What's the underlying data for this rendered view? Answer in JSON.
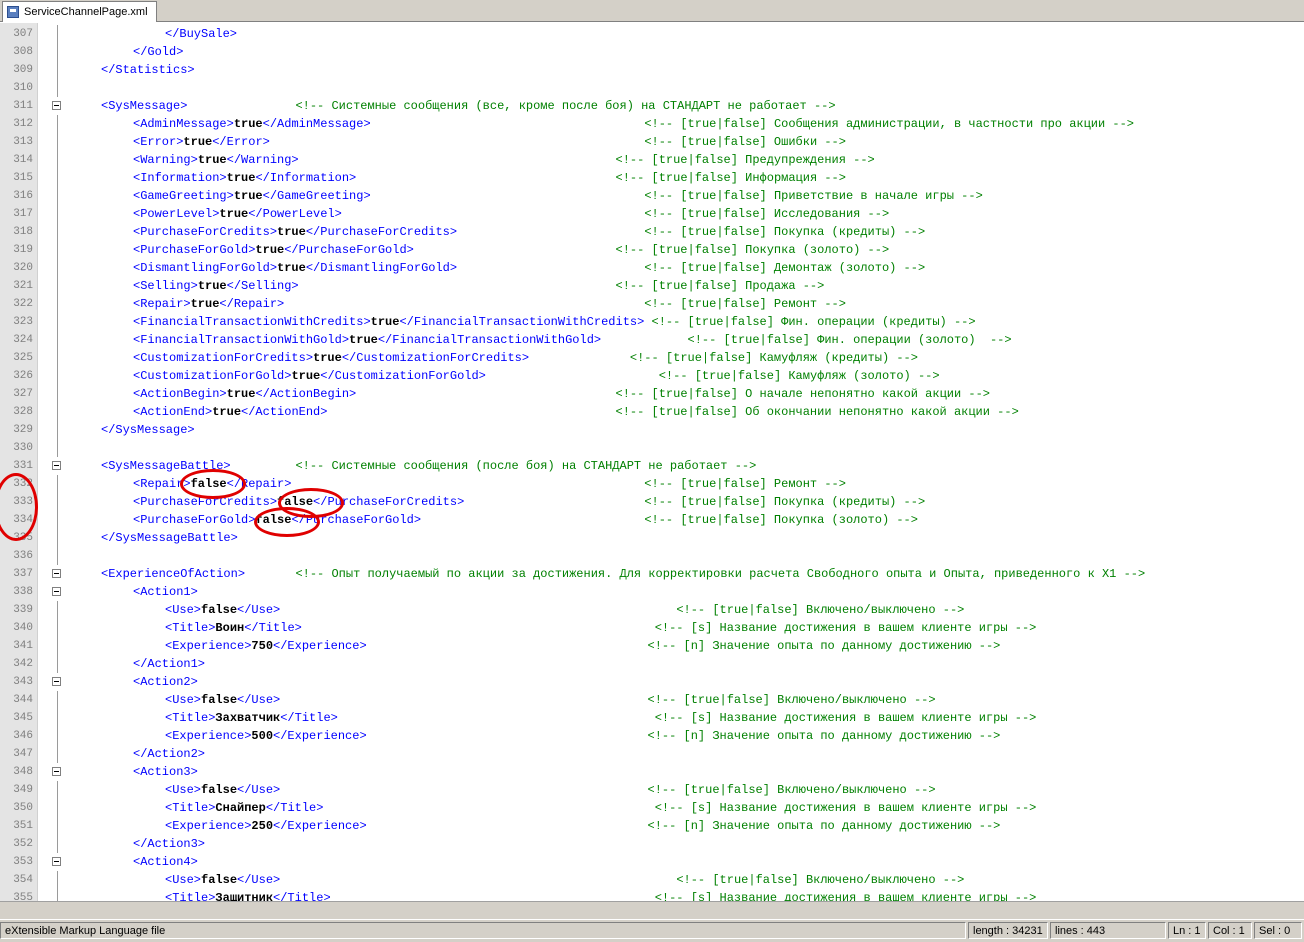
{
  "tab": {
    "filename": "ServiceChannelPage.xml"
  },
  "status": {
    "filetype": "eXtensible Markup Language file",
    "length": "length : 34231",
    "lines": "lines : 443",
    "ln": "Ln : 1",
    "col": "Col : 1",
    "sel": "Sel : 0"
  },
  "lines": [
    {
      "num": "307",
      "indent": 3,
      "parts": [
        [
          "t",
          "</BuySale>"
        ]
      ]
    },
    {
      "num": "308",
      "indent": 2,
      "parts": [
        [
          "t",
          "</Gold>"
        ]
      ]
    },
    {
      "num": "309",
      "indent": 1,
      "parts": [
        [
          "t",
          "</Statistics>"
        ]
      ]
    },
    {
      "num": "310",
      "indent": 0,
      "parts": []
    },
    {
      "num": "311",
      "indent": 1,
      "fold": true,
      "parts": [
        [
          "t",
          "<SysMessage>"
        ],
        [
          "s",
          "               "
        ],
        [
          "c",
          "<!-- Системные сообщения (все, кроме после боя) на СТАНДАРТ не работает -->"
        ]
      ]
    },
    {
      "num": "312",
      "indent": 2,
      "parts": [
        [
          "t",
          "<AdminMessage>"
        ],
        [
          "v",
          "true"
        ],
        [
          "t",
          "</AdminMessage>"
        ],
        [
          "s",
          "                                      "
        ],
        [
          "c",
          "<!-- [true|false] Сообщения администрации, в частности про акции -->"
        ]
      ]
    },
    {
      "num": "313",
      "indent": 2,
      "parts": [
        [
          "t",
          "<Error>"
        ],
        [
          "v",
          "true"
        ],
        [
          "t",
          "</Error>"
        ],
        [
          "s",
          "                                                    "
        ],
        [
          "c",
          "<!-- [true|false] Ошибки -->"
        ]
      ]
    },
    {
      "num": "314",
      "indent": 2,
      "parts": [
        [
          "t",
          "<Warning>"
        ],
        [
          "v",
          "true"
        ],
        [
          "t",
          "</Warning>"
        ],
        [
          "s",
          "                                            "
        ],
        [
          "c",
          "<!-- [true|false] Предупреждения -->"
        ]
      ]
    },
    {
      "num": "315",
      "indent": 2,
      "parts": [
        [
          "t",
          "<Information>"
        ],
        [
          "v",
          "true"
        ],
        [
          "t",
          "</Information>"
        ],
        [
          "s",
          "                                    "
        ],
        [
          "c",
          "<!-- [true|false] Информация -->"
        ]
      ]
    },
    {
      "num": "316",
      "indent": 2,
      "parts": [
        [
          "t",
          "<GameGreeting>"
        ],
        [
          "v",
          "true"
        ],
        [
          "t",
          "</GameGreeting>"
        ],
        [
          "s",
          "                                      "
        ],
        [
          "c",
          "<!-- [true|false] Приветствие в начале игры -->"
        ]
      ]
    },
    {
      "num": "317",
      "indent": 2,
      "parts": [
        [
          "t",
          "<PowerLevel>"
        ],
        [
          "v",
          "true"
        ],
        [
          "t",
          "</PowerLevel>"
        ],
        [
          "s",
          "                                          "
        ],
        [
          "c",
          "<!-- [true|false] Исследования -->"
        ]
      ]
    },
    {
      "num": "318",
      "indent": 2,
      "parts": [
        [
          "t",
          "<PurchaseForCredits>"
        ],
        [
          "v",
          "true"
        ],
        [
          "t",
          "</PurchaseForCredits>"
        ],
        [
          "s",
          "                          "
        ],
        [
          "c",
          "<!-- [true|false] Покупка (кредиты) -->"
        ]
      ]
    },
    {
      "num": "319",
      "indent": 2,
      "parts": [
        [
          "t",
          "<PurchaseForGold>"
        ],
        [
          "v",
          "true"
        ],
        [
          "t",
          "</PurchaseForGold>"
        ],
        [
          "s",
          "                            "
        ],
        [
          "c",
          "<!-- [true|false] Покупка (золото) -->"
        ]
      ]
    },
    {
      "num": "320",
      "indent": 2,
      "parts": [
        [
          "t",
          "<DismantlingForGold>"
        ],
        [
          "v",
          "true"
        ],
        [
          "t",
          "</DismantlingForGold>"
        ],
        [
          "s",
          "                          "
        ],
        [
          "c",
          "<!-- [true|false] Демонтаж (золото) -->"
        ]
      ]
    },
    {
      "num": "321",
      "indent": 2,
      "parts": [
        [
          "t",
          "<Selling>"
        ],
        [
          "v",
          "true"
        ],
        [
          "t",
          "</Selling>"
        ],
        [
          "s",
          "                                            "
        ],
        [
          "c",
          "<!-- [true|false] Продажа -->"
        ]
      ]
    },
    {
      "num": "322",
      "indent": 2,
      "parts": [
        [
          "t",
          "<Repair>"
        ],
        [
          "v",
          "true"
        ],
        [
          "t",
          "</Repair>"
        ],
        [
          "s",
          "                                                  "
        ],
        [
          "c",
          "<!-- [true|false] Ремонт -->"
        ]
      ]
    },
    {
      "num": "323",
      "indent": 2,
      "parts": [
        [
          "t",
          "<FinancialTransactionWithCredits>"
        ],
        [
          "v",
          "true"
        ],
        [
          "t",
          "</FinancialTransactionWithCredits>"
        ],
        [
          "s",
          " "
        ],
        [
          "c",
          "<!-- [true|false] Фин. операции (кредиты) -->"
        ]
      ]
    },
    {
      "num": "324",
      "indent": 2,
      "parts": [
        [
          "t",
          "<FinancialTransactionWithGold>"
        ],
        [
          "v",
          "true"
        ],
        [
          "t",
          "</FinancialTransactionWithGold>"
        ],
        [
          "s",
          "            "
        ],
        [
          "c",
          "<!-- [true|false] Фин. операции (золото)  -->"
        ]
      ]
    },
    {
      "num": "325",
      "indent": 2,
      "parts": [
        [
          "t",
          "<CustomizationForCredits>"
        ],
        [
          "v",
          "true"
        ],
        [
          "t",
          "</CustomizationForCredits>"
        ],
        [
          "s",
          "              "
        ],
        [
          "c",
          "<!-- [true|false] Камуфляж (кредиты) -->"
        ]
      ]
    },
    {
      "num": "326",
      "indent": 2,
      "parts": [
        [
          "t",
          "<CustomizationForGold>"
        ],
        [
          "v",
          "true"
        ],
        [
          "t",
          "</CustomizationForGold>"
        ],
        [
          "s",
          "                        "
        ],
        [
          "c",
          "<!-- [true|false] Камуфляж (золото) -->"
        ]
      ]
    },
    {
      "num": "327",
      "indent": 2,
      "parts": [
        [
          "t",
          "<ActionBegin>"
        ],
        [
          "v",
          "true"
        ],
        [
          "t",
          "</ActionBegin>"
        ],
        [
          "s",
          "                                    "
        ],
        [
          "c",
          "<!-- [true|false] О начале непонятно какой акции -->"
        ]
      ]
    },
    {
      "num": "328",
      "indent": 2,
      "parts": [
        [
          "t",
          "<ActionEnd>"
        ],
        [
          "v",
          "true"
        ],
        [
          "t",
          "</ActionEnd>"
        ],
        [
          "s",
          "                                        "
        ],
        [
          "c",
          "<!-- [true|false] Об окончании непонятно какой акции -->"
        ]
      ]
    },
    {
      "num": "329",
      "indent": 1,
      "parts": [
        [
          "t",
          "</SysMessage>"
        ]
      ]
    },
    {
      "num": "330",
      "indent": 0,
      "parts": []
    },
    {
      "num": "331",
      "indent": 1,
      "fold": true,
      "parts": [
        [
          "t",
          "<SysMessageBattle>"
        ],
        [
          "s",
          "         "
        ],
        [
          "c",
          "<!-- Системные сообщения (после боя) на СТАНДАРТ не работает -->"
        ]
      ]
    },
    {
      "num": "332",
      "indent": 2,
      "parts": [
        [
          "t",
          "<Repair>"
        ],
        [
          "v",
          "false"
        ],
        [
          "t",
          "</Repair>"
        ],
        [
          "s",
          "                                                 "
        ],
        [
          "c",
          "<!-- [true|false] Ремонт -->"
        ]
      ]
    },
    {
      "num": "333",
      "indent": 2,
      "parts": [
        [
          "t",
          "<PurchaseForCredits>"
        ],
        [
          "v",
          "false"
        ],
        [
          "t",
          "</PurchaseForCredits>"
        ],
        [
          "s",
          "                         "
        ],
        [
          "c",
          "<!-- [true|false] Покупка (кредиты) -->"
        ]
      ]
    },
    {
      "num": "334",
      "indent": 2,
      "parts": [
        [
          "t",
          "<PurchaseForGold>"
        ],
        [
          "v",
          "false"
        ],
        [
          "t",
          "</PurchaseForGold>"
        ],
        [
          "s",
          "                               "
        ],
        [
          "c",
          "<!-- [true|false] Покупка (золото) -->"
        ]
      ]
    },
    {
      "num": "335",
      "indent": 1,
      "parts": [
        [
          "t",
          "</SysMessageBattle>"
        ]
      ]
    },
    {
      "num": "336",
      "indent": 0,
      "parts": []
    },
    {
      "num": "337",
      "indent": 1,
      "fold": true,
      "parts": [
        [
          "t",
          "<ExperienceOfAction>"
        ],
        [
          "s",
          "       "
        ],
        [
          "c",
          "<!-- Опыт получаемый по акции за достижения. Для корректировки расчета Свободного опыта и Опыта, приведенного к X1 -->"
        ]
      ]
    },
    {
      "num": "338",
      "indent": 2,
      "fold": true,
      "parts": [
        [
          "t",
          "<Action1>"
        ]
      ]
    },
    {
      "num": "339",
      "indent": 3,
      "parts": [
        [
          "t",
          "<Use>"
        ],
        [
          "v",
          "false"
        ],
        [
          "t",
          "</Use>"
        ],
        [
          "s",
          "                                                       "
        ],
        [
          "c",
          "<!-- [true|false] Включено/выключено -->"
        ]
      ]
    },
    {
      "num": "340",
      "indent": 3,
      "parts": [
        [
          "t",
          "<Title>"
        ],
        [
          "v",
          "Воин"
        ],
        [
          "t",
          "</Title>"
        ],
        [
          "s",
          "                                                 "
        ],
        [
          "c",
          "<!-- [s] Название достижения в вашем клиенте игры -->"
        ]
      ]
    },
    {
      "num": "341",
      "indent": 3,
      "parts": [
        [
          "t",
          "<Experience>"
        ],
        [
          "v",
          "750"
        ],
        [
          "t",
          "</Experience>"
        ],
        [
          "s",
          "                                       "
        ],
        [
          "c",
          "<!-- [n] Значение опыта по данному достижению -->"
        ]
      ]
    },
    {
      "num": "342",
      "indent": 2,
      "parts": [
        [
          "t",
          "</Action1>"
        ]
      ]
    },
    {
      "num": "343",
      "indent": 2,
      "fold": true,
      "parts": [
        [
          "t",
          "<Action2>"
        ]
      ]
    },
    {
      "num": "344",
      "indent": 3,
      "parts": [
        [
          "t",
          "<Use>"
        ],
        [
          "v",
          "false"
        ],
        [
          "t",
          "</Use>"
        ],
        [
          "s",
          "                                                   "
        ],
        [
          "c",
          "<!-- [true|false] Включено/выключено -->"
        ]
      ]
    },
    {
      "num": "345",
      "indent": 3,
      "parts": [
        [
          "t",
          "<Title>"
        ],
        [
          "v",
          "Захватчик"
        ],
        [
          "t",
          "</Title>"
        ],
        [
          "s",
          "                                            "
        ],
        [
          "c",
          "<!-- [s] Название достижения в вашем клиенте игры -->"
        ]
      ]
    },
    {
      "num": "346",
      "indent": 3,
      "parts": [
        [
          "t",
          "<Experience>"
        ],
        [
          "v",
          "500"
        ],
        [
          "t",
          "</Experience>"
        ],
        [
          "s",
          "                                       "
        ],
        [
          "c",
          "<!-- [n] Значение опыта по данному достижению -->"
        ]
      ]
    },
    {
      "num": "347",
      "indent": 2,
      "parts": [
        [
          "t",
          "</Action2>"
        ]
      ]
    },
    {
      "num": "348",
      "indent": 2,
      "fold": true,
      "parts": [
        [
          "t",
          "<Action3>"
        ]
      ]
    },
    {
      "num": "349",
      "indent": 3,
      "parts": [
        [
          "t",
          "<Use>"
        ],
        [
          "v",
          "false"
        ],
        [
          "t",
          "</Use>"
        ],
        [
          "s",
          "                                                   "
        ],
        [
          "c",
          "<!-- [true|false] Включено/выключено -->"
        ]
      ]
    },
    {
      "num": "350",
      "indent": 3,
      "parts": [
        [
          "t",
          "<Title>"
        ],
        [
          "v",
          "Снайпер"
        ],
        [
          "t",
          "</Title>"
        ],
        [
          "s",
          "                                              "
        ],
        [
          "c",
          "<!-- [s] Название достижения в вашем клиенте игры -->"
        ]
      ]
    },
    {
      "num": "351",
      "indent": 3,
      "parts": [
        [
          "t",
          "<Experience>"
        ],
        [
          "v",
          "250"
        ],
        [
          "t",
          "</Experience>"
        ],
        [
          "s",
          "                                       "
        ],
        [
          "c",
          "<!-- [n] Значение опыта по данному достижению -->"
        ]
      ]
    },
    {
      "num": "352",
      "indent": 2,
      "parts": [
        [
          "t",
          "</Action3>"
        ]
      ]
    },
    {
      "num": "353",
      "indent": 2,
      "fold": true,
      "parts": [
        [
          "t",
          "<Action4>"
        ]
      ]
    },
    {
      "num": "354",
      "indent": 3,
      "parts": [
        [
          "t",
          "<Use>"
        ],
        [
          "v",
          "false"
        ],
        [
          "t",
          "</Use>"
        ],
        [
          "s",
          "                                                       "
        ],
        [
          "c",
          "<!-- [true|false] Включено/выключено -->"
        ]
      ]
    },
    {
      "num": "355",
      "indent": 3,
      "parts": [
        [
          "t",
          "<Title>"
        ],
        [
          "v",
          "Защитник"
        ],
        [
          "t",
          "</Title>"
        ],
        [
          "s",
          "                                             "
        ],
        [
          "c",
          "<!-- [s] Название достижения в вашем клиенте игры -->"
        ]
      ]
    }
  ]
}
